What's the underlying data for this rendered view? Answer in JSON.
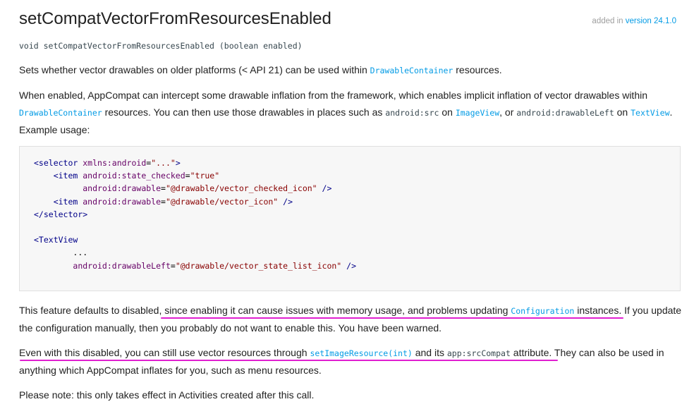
{
  "header": {
    "title": "setCompatVectorFromResourcesEnabled",
    "added_prefix": "added in ",
    "added_version": "version 24.1.0"
  },
  "signature": "void setCompatVectorFromResourcesEnabled (boolean enabled)",
  "para1": {
    "t1": "Sets whether vector drawables on older platforms (< API 21) can be used within ",
    "link": "DrawableContainer",
    "t2": " resources."
  },
  "para2": {
    "t1": "When enabled, AppCompat can intercept some drawable inflation from the framework, which enables implicit inflation of vector drawables within ",
    "link1": "DrawableContainer",
    "t2": " resources. You can then use those drawables in places such as ",
    "code1": "android:src",
    "t3": " on ",
    "link2": "ImageView",
    "t4": ", or ",
    "code2": "android:drawableLeft",
    "t5": " on ",
    "link3": "TextView",
    "t6": ". Example usage:"
  },
  "code_block": {
    "l1_tag": "<selector ",
    "l1_attr": "xmlns:android",
    "l1_eq": "=",
    "l1_val": "\"...\"",
    "l1_end": ">",
    "l2_tag": "<item ",
    "l2_attr": "android:state_checked",
    "l2_eq": "=",
    "l2_val": "\"true\"",
    "l3_attr": "android:drawable",
    "l3_eq": "=",
    "l3_val": "\"@drawable/vector_checked_icon\"",
    "l3_end": " />",
    "l4_tag": "<item ",
    "l4_attr": "android:drawable",
    "l4_eq": "=",
    "l4_val": "\"@drawable/vector_icon\"",
    "l4_end": " />",
    "l5_tag": "</selector>",
    "l7_tag": "<TextView",
    "l8_plain": "...",
    "l9_attr": "android:drawableLeft",
    "l9_eq": "=",
    "l9_val": "\"@drawable/vector_state_list_icon\"",
    "l9_end": " />"
  },
  "para3": {
    "t1": "This feature defaults to disabled, since enabling it can cause issues with memory usage, and problems updating ",
    "link": "Configuration",
    "t2": " instances. If you update the configuration manually, then you probably do not want to enable this. You have been warned."
  },
  "para4": {
    "t1": "Even with this disabled, you can still use vector resources through ",
    "link": "setImageResource(int)",
    "t2": " and its ",
    "code": "app:srcCompat",
    "t3": " attribute. They can also be used in anything which AppCompat inflates for you, such as menu resources."
  },
  "para5": {
    "t1": "Please note: this only takes effect in Activities created after this call."
  },
  "colors": {
    "link": "#039be5",
    "annotation": "#e020d0",
    "code_bg": "#f7f7f7"
  }
}
